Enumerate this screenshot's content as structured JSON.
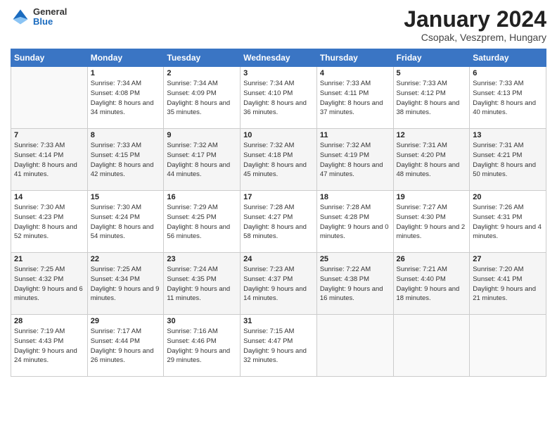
{
  "logo": {
    "general": "General",
    "blue": "Blue"
  },
  "header": {
    "month": "January 2024",
    "location": "Csopak, Veszprem, Hungary"
  },
  "weekdays": [
    "Sunday",
    "Monday",
    "Tuesday",
    "Wednesday",
    "Thursday",
    "Friday",
    "Saturday"
  ],
  "weeks": [
    [
      {
        "day": "",
        "sunrise": "",
        "sunset": "",
        "daylight": ""
      },
      {
        "day": "1",
        "sunrise": "Sunrise: 7:34 AM",
        "sunset": "Sunset: 4:08 PM",
        "daylight": "Daylight: 8 hours and 34 minutes."
      },
      {
        "day": "2",
        "sunrise": "Sunrise: 7:34 AM",
        "sunset": "Sunset: 4:09 PM",
        "daylight": "Daylight: 8 hours and 35 minutes."
      },
      {
        "day": "3",
        "sunrise": "Sunrise: 7:34 AM",
        "sunset": "Sunset: 4:10 PM",
        "daylight": "Daylight: 8 hours and 36 minutes."
      },
      {
        "day": "4",
        "sunrise": "Sunrise: 7:33 AM",
        "sunset": "Sunset: 4:11 PM",
        "daylight": "Daylight: 8 hours and 37 minutes."
      },
      {
        "day": "5",
        "sunrise": "Sunrise: 7:33 AM",
        "sunset": "Sunset: 4:12 PM",
        "daylight": "Daylight: 8 hours and 38 minutes."
      },
      {
        "day": "6",
        "sunrise": "Sunrise: 7:33 AM",
        "sunset": "Sunset: 4:13 PM",
        "daylight": "Daylight: 8 hours and 40 minutes."
      }
    ],
    [
      {
        "day": "7",
        "sunrise": "Sunrise: 7:33 AM",
        "sunset": "Sunset: 4:14 PM",
        "daylight": "Daylight: 8 hours and 41 minutes."
      },
      {
        "day": "8",
        "sunrise": "Sunrise: 7:33 AM",
        "sunset": "Sunset: 4:15 PM",
        "daylight": "Daylight: 8 hours and 42 minutes."
      },
      {
        "day": "9",
        "sunrise": "Sunrise: 7:32 AM",
        "sunset": "Sunset: 4:17 PM",
        "daylight": "Daylight: 8 hours and 44 minutes."
      },
      {
        "day": "10",
        "sunrise": "Sunrise: 7:32 AM",
        "sunset": "Sunset: 4:18 PM",
        "daylight": "Daylight: 8 hours and 45 minutes."
      },
      {
        "day": "11",
        "sunrise": "Sunrise: 7:32 AM",
        "sunset": "Sunset: 4:19 PM",
        "daylight": "Daylight: 8 hours and 47 minutes."
      },
      {
        "day": "12",
        "sunrise": "Sunrise: 7:31 AM",
        "sunset": "Sunset: 4:20 PM",
        "daylight": "Daylight: 8 hours and 48 minutes."
      },
      {
        "day": "13",
        "sunrise": "Sunrise: 7:31 AM",
        "sunset": "Sunset: 4:21 PM",
        "daylight": "Daylight: 8 hours and 50 minutes."
      }
    ],
    [
      {
        "day": "14",
        "sunrise": "Sunrise: 7:30 AM",
        "sunset": "Sunset: 4:23 PM",
        "daylight": "Daylight: 8 hours and 52 minutes."
      },
      {
        "day": "15",
        "sunrise": "Sunrise: 7:30 AM",
        "sunset": "Sunset: 4:24 PM",
        "daylight": "Daylight: 8 hours and 54 minutes."
      },
      {
        "day": "16",
        "sunrise": "Sunrise: 7:29 AM",
        "sunset": "Sunset: 4:25 PM",
        "daylight": "Daylight: 8 hours and 56 minutes."
      },
      {
        "day": "17",
        "sunrise": "Sunrise: 7:28 AM",
        "sunset": "Sunset: 4:27 PM",
        "daylight": "Daylight: 8 hours and 58 minutes."
      },
      {
        "day": "18",
        "sunrise": "Sunrise: 7:28 AM",
        "sunset": "Sunset: 4:28 PM",
        "daylight": "Daylight: 9 hours and 0 minutes."
      },
      {
        "day": "19",
        "sunrise": "Sunrise: 7:27 AM",
        "sunset": "Sunset: 4:30 PM",
        "daylight": "Daylight: 9 hours and 2 minutes."
      },
      {
        "day": "20",
        "sunrise": "Sunrise: 7:26 AM",
        "sunset": "Sunset: 4:31 PM",
        "daylight": "Daylight: 9 hours and 4 minutes."
      }
    ],
    [
      {
        "day": "21",
        "sunrise": "Sunrise: 7:25 AM",
        "sunset": "Sunset: 4:32 PM",
        "daylight": "Daylight: 9 hours and 6 minutes."
      },
      {
        "day": "22",
        "sunrise": "Sunrise: 7:25 AM",
        "sunset": "Sunset: 4:34 PM",
        "daylight": "Daylight: 9 hours and 9 minutes."
      },
      {
        "day": "23",
        "sunrise": "Sunrise: 7:24 AM",
        "sunset": "Sunset: 4:35 PM",
        "daylight": "Daylight: 9 hours and 11 minutes."
      },
      {
        "day": "24",
        "sunrise": "Sunrise: 7:23 AM",
        "sunset": "Sunset: 4:37 PM",
        "daylight": "Daylight: 9 hours and 14 minutes."
      },
      {
        "day": "25",
        "sunrise": "Sunrise: 7:22 AM",
        "sunset": "Sunset: 4:38 PM",
        "daylight": "Daylight: 9 hours and 16 minutes."
      },
      {
        "day": "26",
        "sunrise": "Sunrise: 7:21 AM",
        "sunset": "Sunset: 4:40 PM",
        "daylight": "Daylight: 9 hours and 18 minutes."
      },
      {
        "day": "27",
        "sunrise": "Sunrise: 7:20 AM",
        "sunset": "Sunset: 4:41 PM",
        "daylight": "Daylight: 9 hours and 21 minutes."
      }
    ],
    [
      {
        "day": "28",
        "sunrise": "Sunrise: 7:19 AM",
        "sunset": "Sunset: 4:43 PM",
        "daylight": "Daylight: 9 hours and 24 minutes."
      },
      {
        "day": "29",
        "sunrise": "Sunrise: 7:17 AM",
        "sunset": "Sunset: 4:44 PM",
        "daylight": "Daylight: 9 hours and 26 minutes."
      },
      {
        "day": "30",
        "sunrise": "Sunrise: 7:16 AM",
        "sunset": "Sunset: 4:46 PM",
        "daylight": "Daylight: 9 hours and 29 minutes."
      },
      {
        "day": "31",
        "sunrise": "Sunrise: 7:15 AM",
        "sunset": "Sunset: 4:47 PM",
        "daylight": "Daylight: 9 hours and 32 minutes."
      },
      {
        "day": "",
        "sunrise": "",
        "sunset": "",
        "daylight": ""
      },
      {
        "day": "",
        "sunrise": "",
        "sunset": "",
        "daylight": ""
      },
      {
        "day": "",
        "sunrise": "",
        "sunset": "",
        "daylight": ""
      }
    ]
  ]
}
